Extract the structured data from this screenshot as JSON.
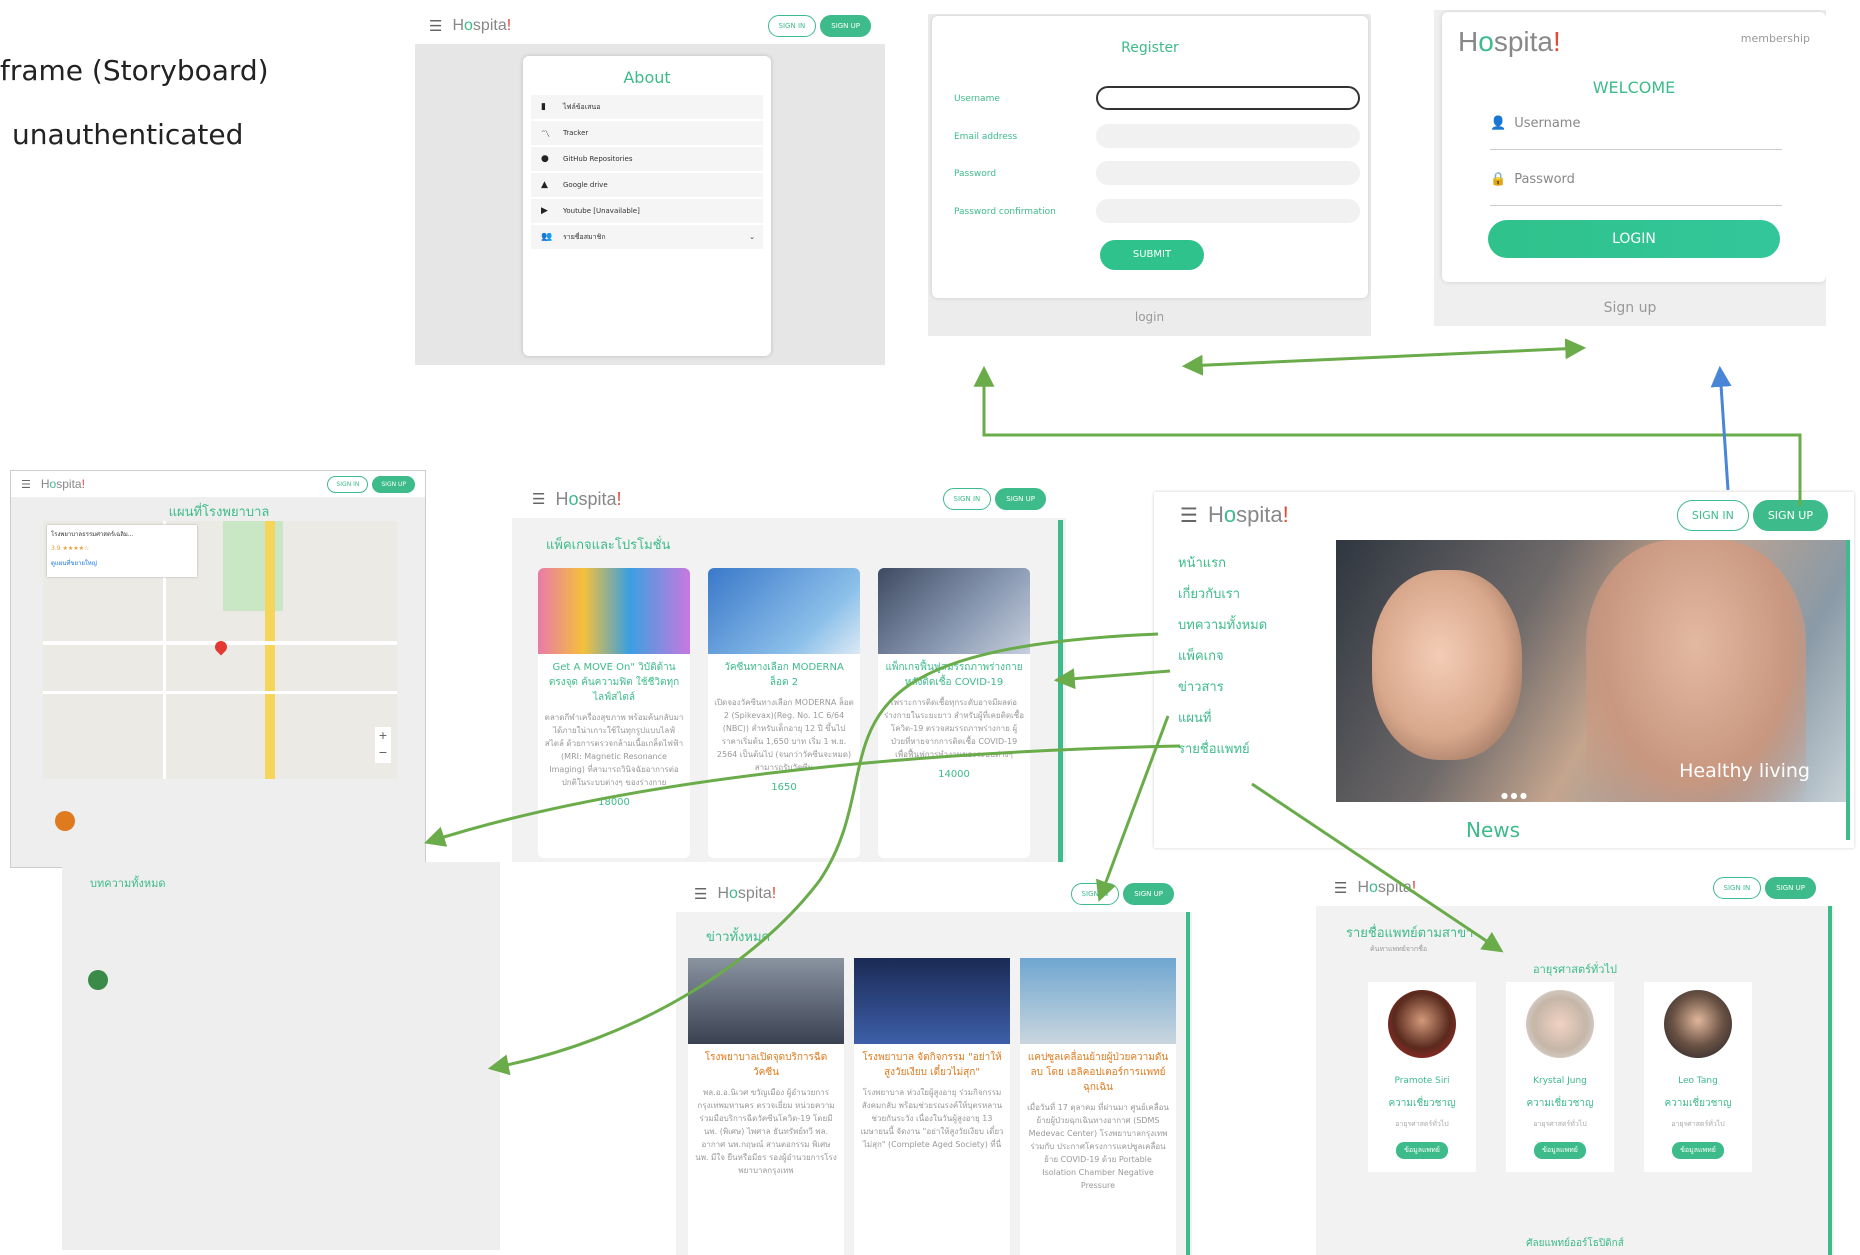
{
  "slide": {
    "heading1": "frame (Storyboard)",
    "heading2": "unauthenticated"
  },
  "brand": {
    "pre": "H",
    "o": "o",
    "post": "spita",
    "dot": "!"
  },
  "header": {
    "menu_icon": "menu-icon",
    "signin": "SIGN IN",
    "signup": "SIGN UP"
  },
  "about": {
    "title": "About",
    "items": [
      {
        "icon": "file-icon",
        "label": "ไฟล์ข้อเสนอ"
      },
      {
        "icon": "chart-line-icon",
        "label": "Tracker"
      },
      {
        "icon": "github-icon",
        "label": "GitHub Repositories"
      },
      {
        "icon": "google-drive-icon",
        "label": "Google drive"
      },
      {
        "icon": "youtube-icon",
        "label": "Youtube [Unavailable]"
      },
      {
        "icon": "users-icon",
        "label": "รายชื่อสมาชิก"
      }
    ]
  },
  "register": {
    "title": "Register",
    "labels": [
      "Username",
      "Email address",
      "Password",
      "Password confirmation"
    ],
    "submit": "SUBMIT",
    "login_link": "login"
  },
  "login": {
    "membership": "membership",
    "welcome": "WELCOME",
    "username_placeholder": "Username",
    "password_placeholder": "Password",
    "login_btn": "LOGIN",
    "signup_link": "Sign up"
  },
  "home": {
    "nav": [
      "หน้าแรก",
      "เกี่ยวกับเรา",
      "บทความทั้งหมด",
      "แพ็คเกจ",
      "ข่าวสาร",
      "แผนที่",
      "รายชื่อแพทย์"
    ],
    "hero_caption": "Healthy living",
    "news_title": "News"
  },
  "map": {
    "title": "แผนที่โรงพยาบาล",
    "place_name": "โรงพยาบาลธรรมศาสตร์เฉลิม...",
    "rating": "3.9 ★★★★☆",
    "directions": "ดูแผนที่ขยายใหญ่",
    "zoom_in": "+",
    "zoom_out": "−"
  },
  "articles": {
    "title": "บทความทั้งหมด"
  },
  "packages": {
    "title": "แพ็คเกจและโปรโมชั่น",
    "cards": [
      {
        "title": "Get A MOVE On\" วิบัติด้าน ตรงจุด ค้นความฟิต ใช้ชีวิตทุกไลฟ์สไตล์",
        "body": "ตลาดกีฬาเครื่องสุขภาพ พร้อมค้นกลับมาได้ภายใน่าเกาะใช้ในทุกรูปแบบไลฟ์สไตล์ ด้วยการตรวจกล้ามเนื้อเกล็ดไฟฟ้า (MRI: Magnetic Resonance Imaging) ที่สามารถวินิจฉัยอาการต่อ ปกติในระบบต่างๆ ของร่างกาย",
        "price": "18000"
      },
      {
        "title": "วัคซีนทางเลือก MODERNA ล็อต 2",
        "body": "เปิดจองวัคซีนทางเลือก MODERNA ล็อต 2 (Spikevax)(Reg. No. 1C 6/64 (NBC)) สำหรับเด็กอายุ 12 ปี ขึ้นไป ราคาเริ่มต้น 1,650 บาท เริ่ม 1 พ.ย. 2564 เป็นต้นไป (จนกว่าวัคซีนจะหมด) สามารถรับวัคซีน",
        "price": "1650"
      },
      {
        "title": "แพ็กเกจฟื้นฟูสมรรถภาพร่างกายหลังติดเชื้อ COVID-19",
        "body": "เพราะการติดเชื้อทุกระดับอาจมีผลต่อร่างกายในระยะยาว สำหรับผู้ที่เคยติดเชื้อโควิด-19 ตรวจสมรรถภาพร่างกาย ผู้ป่วยที่หายจากการติดเชื้อ COVID-19 เพื่อฟื้นฟูการทำงานของระบบต่างๆ",
        "price": "14000"
      }
    ]
  },
  "news": {
    "title": "ข่าวทั้งหมด",
    "cards": [
      {
        "title": "โรงพยาบาลเปิดจุดบริการฉีดวัคซีน",
        "body": "พล.อ.อ.นิเวศ ขวัญเมือง ผู้อำนวยการ กรุงเทพมหานคร ตรวจเยี่ยม หน่วยความร่วมมือบริการฉีดวัคซีนโควิด-19 โดยมี นพ. (พิเศษ) ไพศาล ธันทรัพย์ทวี พล. อากาศ นพ.กฤษณ์ สานตอกรรม พิเศษ นพ. มีใจ ยืนหรือมีธร รองผู้อำนวยการโรงพยาบาลกรุงเทพ"
      },
      {
        "title": "โรงพยาบาล จัดกิจกรรม \"อย่าให้สูงวัยเงียบ เดี๋ยวไม่สุก\"",
        "body": "โรงพยาบาล ห่วงใยผู้สูงอายุ ร่วมกิจกรรมสังคมกลับ พร้อมช่วยรณรงค์ให้บุตรหลานช่วยกันระวัง เนื่องในวันผู้สูงอายุ 13 เมษายนนี้ จัดงาน \"อย่าให้สูงวัยเงียบ เดี๋ยวไม่สุก\" (Complete Aged Society) ที่นี่"
      },
      {
        "title": "แคปซูลเคลื่อนย้ายผู้ป่วยความดันลบ โดย เฮลิคอปเตอร์การแพทย์ฉุกเฉิน",
        "body": "เมื่อวันที่ 17 ตุลาคม ที่ผ่านมา ศูนย์เคลื่อนย้ายผู้ป่วยฉุกเฉินทางอากาศ (SDMS Medevac Center) โรงพยาบาลกรุงเทพ ร่วมกับ ประกาศโครงการแคปซูลเคลื่อนย้าย COVID-19 ด้วย Portable Isolation Chamber Negative Pressure"
      }
    ]
  },
  "doctors": {
    "title": "รายชื่อแพทย์ตามสาขา",
    "subtitle": "ค้นหาแพทย์จากชื่อ",
    "section": "อายุรศาสตร์ทั่วไป",
    "section2": "ศัลยแพทย์ออร์โธปิดิกส์",
    "list": [
      {
        "name": "Pramote Siri",
        "expertise": "ความเชี่ยวชาญ",
        "dept": "อายุรศาสตร์ทั่วไป",
        "btn": "ข้อมูลแพทย์"
      },
      {
        "name": "Krystal Jung",
        "expertise": "ความเชี่ยวชาญ",
        "dept": "อายุรศาสตร์ทั่วไป",
        "btn": "ข้อมูลแพทย์"
      },
      {
        "name": "Leo Tang",
        "expertise": "ความเชี่ยวชาญ",
        "dept": "อายุรศาสตร์ทั่วไป",
        "btn": "ข้อมูลแพทย์"
      }
    ]
  },
  "colors": {
    "accent": "#3dbb8a",
    "arrow": "#6aab4a",
    "arrow_blue": "#4a86d8"
  }
}
